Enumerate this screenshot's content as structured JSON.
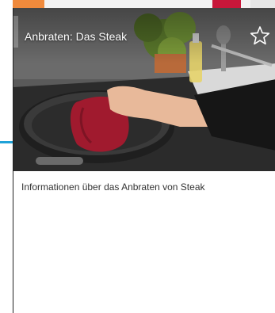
{
  "recipe_step": {
    "title": "Anbraten: Das Steak",
    "description": "Informationen über das Anbraten von Steak",
    "favorite_icon": "star-outline-icon"
  },
  "colors": {
    "accent_blue": "#1fa2d8",
    "strip_orange": "#f08a3c",
    "strip_red": "#c8173a"
  }
}
